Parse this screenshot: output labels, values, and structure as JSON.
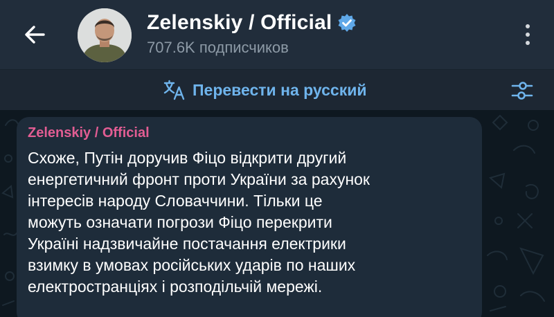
{
  "header": {
    "back_icon": "arrow-left-icon",
    "channel_name": "Zelenskiy / Official",
    "verified_icon": "verified-badge-icon",
    "subscribers": "707.6K подписчиков",
    "menu_icon": "more-vertical-icon"
  },
  "translate_bar": {
    "icon": "translate-icon",
    "label": "Перевести на русский",
    "settings_icon": "sliders-icon"
  },
  "message": {
    "author": "Zelenskiy / Official",
    "lines": [
      "Схоже, Путін доручив Фіцо відкрити другий",
      "енергетичний фронт проти України за рахунок",
      "інтересів народу Словаччини. Тільки це",
      "можуть означати погрози Фіцо перекрити",
      "Україні надзвичайне постачання електрики",
      "взимку в умовах російських ударів по наших",
      "електространціях і розподільчій мережі."
    ]
  },
  "colors": {
    "header_bg": "#212d3b",
    "chat_bg": "#0e1820",
    "bubble_bg": "#1e2c3a",
    "accent_blue": "#6fb4ec",
    "author_pink": "#e25d93",
    "verified_blue": "#5fa8e8"
  }
}
